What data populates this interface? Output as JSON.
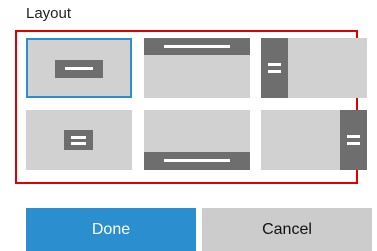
{
  "dialog": {
    "title": "Layout",
    "options": [
      {
        "id": "center-box",
        "selected": true,
        "icon": "center-banner-icon"
      },
      {
        "id": "top-bar",
        "selected": false,
        "icon": "top-banner-icon"
      },
      {
        "id": "left-bar",
        "selected": false,
        "icon": "left-banner-icon"
      },
      {
        "id": "center-small",
        "selected": false,
        "icon": "center-small-icon"
      },
      {
        "id": "bottom-bar",
        "selected": false,
        "icon": "bottom-banner-icon"
      },
      {
        "id": "right-bar",
        "selected": false,
        "icon": "right-banner-icon"
      }
    ],
    "done_label": "Done",
    "cancel_label": "Cancel"
  },
  "colors": {
    "accent": "#2b8fcf",
    "selection_border": "#2f8fce",
    "highlight_frame": "#e00000",
    "tile_bg": "#d1d1d1",
    "bar": "#6e6e6e"
  }
}
